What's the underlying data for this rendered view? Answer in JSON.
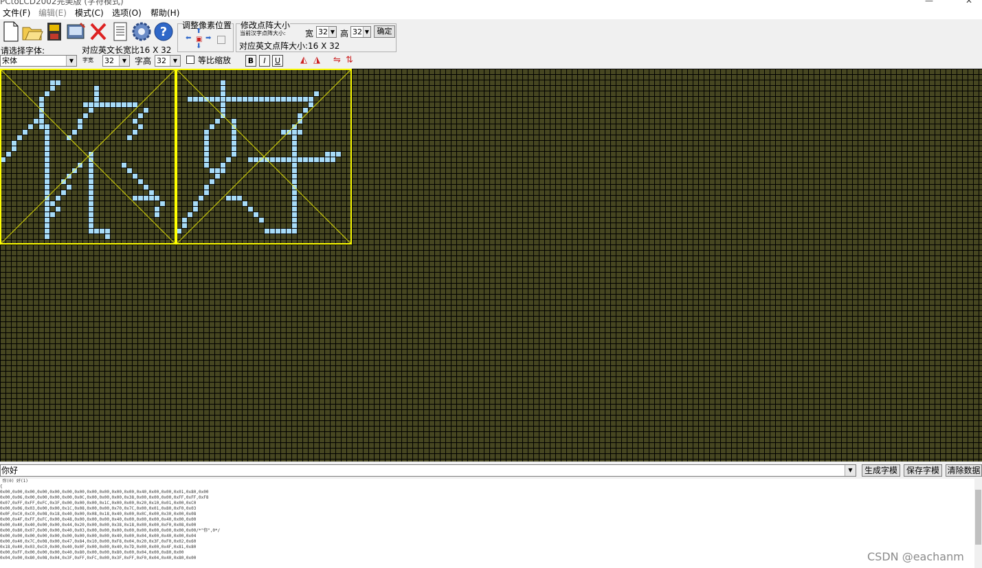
{
  "window": {
    "title": "PCtoLCD2002完美版 (字符模式)"
  },
  "menu": [
    {
      "label": "文件(F)",
      "disabled": false
    },
    {
      "label": "编辑(E)",
      "disabled": true
    },
    {
      "label": "模式(C)",
      "disabled": false
    },
    {
      "label": "选项(O)",
      "disabled": false
    },
    {
      "label": "帮助(H)",
      "disabled": false
    }
  ],
  "toolbar": {
    "font_label": "请选择字体:",
    "font_value": "宋体",
    "ratio_text": "对应英文长宽比16 X 32",
    "char_width_label": "字宽",
    "char_width_value": "32",
    "char_height_label": "字高",
    "char_height_value": "32",
    "proportional_label": "等比缩放",
    "adjust_pixel_label": "调整像素位置",
    "resize_label": "修改点阵大小",
    "current_size_label": "当前汉字点阵大小:",
    "width_label": "宽",
    "width_value": "32",
    "height_label": "高",
    "height_value": "32",
    "confirm_label": "确定",
    "english_size_text": "对应英文点阵大小:16 X 32",
    "bold": "B",
    "italic": "I",
    "underline": "U"
  },
  "editor": {
    "text": "你好",
    "cell_color": "#464621",
    "pixel_color": "#a8dcf8",
    "guide_color": "#ffff00"
  },
  "buttons": {
    "generate": "生成字模",
    "save": "保存字模",
    "clear": "清除数据"
  },
  "output": {
    "header": " 你(0) 好(1)",
    "lines": [
      "{",
      "0x00,0x00,0x00,0x00,0x00,0x00,0x00,0x00,0x00,0x00,0x00,0x40,0x00,0x00,0x01,0x80,0x00",
      "0x00,0x06,0x00,0x00,0x00,0x00,0x0C,0x00,0x00,0x00,0x38,0x00,0x00,0x00,0xFF,0xFF,0xF8",
      "0x07,0xFF,0xFF,0xFC,0x3F,0x00,0x00,0x00,0x1C,0x00,0x00,0x20,0x10,0x01,0x00,0xC0",
      "0x00,0x06,0x03,0x00,0x00,0x1C,0x08,0x00,0x00,0x70,0x7C,0x00,0x01,0x80,0xF0,0x03",
      "0x0F,0xC0,0xC0,0x08,0x18,0x40,0x00,0x08,0x18,0x40,0x00,0x0C,0x00,0x30,0x00,0x08",
      "0x00,0x4F,0xFF,0xFC,0x00,0x48,0x00,0x00,0x00,0x40,0x00,0x00,0x00,0x40,0x00,0x00",
      "0x00,0x40,0x40,0x00,0x00,0x44,0x20,0x00,0x00,0x38,0x18,0x00,0x00,0xF0,0x08,0x00",
      "0x00,0x80,0x07,0x00,0x00,0x40,0x03,0x00,0x00,0x00,0x00,0x00,0x00,0x00,0x00,0x00/*\"你\",0*/",
      "0x00,0x00,0x00,0x00,0x00,0x00,0x00,0x00,0x00,0x40,0x00,0x04,0x00,0x40,0x00,0x04",
      "0x00,0x40,0x7C,0x08,0x00,0x47,0x84,0x10,0x00,0xF8,0x04,0x20,0x3F,0xF0,0x02,0x60",
      "0x18,0x40,0x03,0xC0,0x00,0x40,0x0F,0x00,0x00,0x40,0x7D,0x00,0x00,0x4F,0x81,0x80",
      "0x00,0xFF,0x00,0x00,0x00,0x40,0x80,0x00,0x00,0x80,0x00,0x04,0x00,0x80,0x00",
      "0x04,0x00,0x80,0x08,0x04,0x3F,0xFF,0xFC,0x00,0x3F,0xFF,0xF0,0x04,0x40,0x80,0x00"
    ]
  },
  "watermark": "CSDN @eachanm"
}
